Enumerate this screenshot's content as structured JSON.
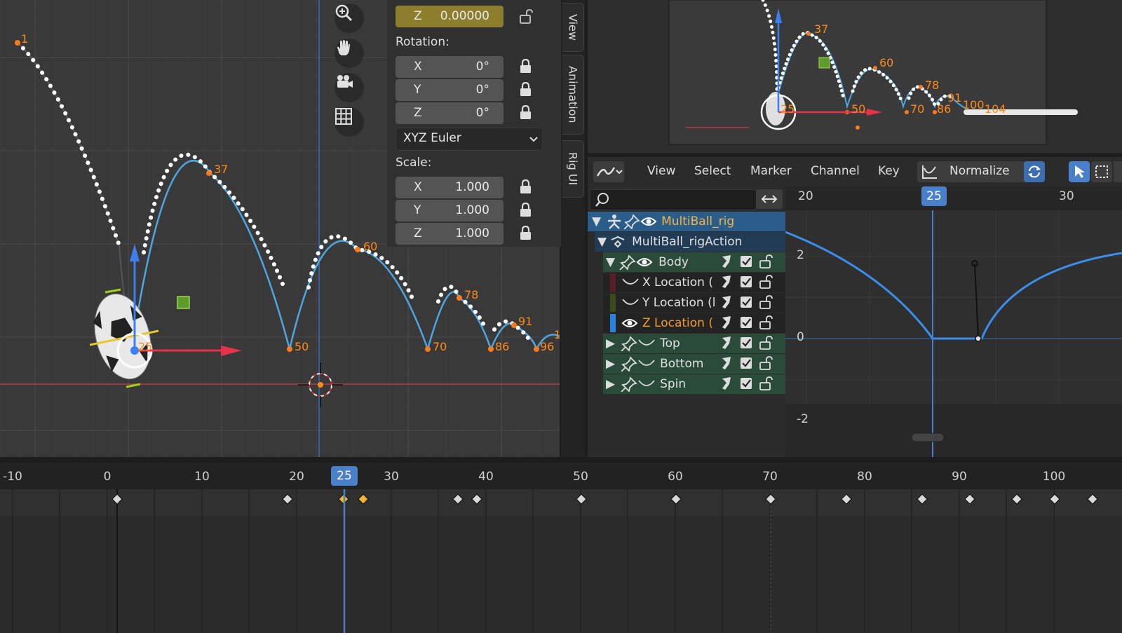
{
  "viewport": {
    "frame_labels": [
      "1",
      "37",
      "60",
      "78",
      "91",
      "25",
      "50",
      "70",
      "86",
      "96",
      "1"
    ],
    "nav_icons": [
      "zoom-icon",
      "hand-pan-icon",
      "camera-icon",
      "grid-icon"
    ]
  },
  "npanel": {
    "location_z": {
      "axis": "Z",
      "value": "0.00000"
    },
    "rotation_label": "Rotation:",
    "rotation": [
      {
        "axis": "X",
        "value": "0°"
      },
      {
        "axis": "Y",
        "value": "0°"
      },
      {
        "axis": "Z",
        "value": "0°"
      }
    ],
    "rotation_mode": "XYZ Euler",
    "scale_label": "Scale:",
    "scale": [
      {
        "axis": "X",
        "value": "1.000"
      },
      {
        "axis": "Y",
        "value": "1.000"
      },
      {
        "axis": "Z",
        "value": "1.000"
      }
    ]
  },
  "side_tabs": [
    "View",
    "Animation",
    "Rig UI"
  ],
  "preview": {
    "frame_labels": [
      "37",
      "60",
      "78",
      "91",
      "25",
      "50",
      "70",
      "86",
      "100",
      "104"
    ]
  },
  "graph": {
    "menu": [
      "View",
      "Select",
      "Marker",
      "Channel",
      "Key"
    ],
    "normalize_label": "Normalize",
    "search_placeholder": "",
    "ruler": {
      "left": "20",
      "current": "25",
      "right": "30"
    },
    "y_ticks": [
      "2",
      "0",
      "-2"
    ],
    "channels": [
      {
        "label": "MultiBall_rig",
        "level": 0
      },
      {
        "label": "MultiBall_rigAction",
        "level": 1
      },
      {
        "label": "Body",
        "level": 2
      },
      {
        "label": "X Location (",
        "level": 3
      },
      {
        "label": "Y Location (l",
        "level": 3
      },
      {
        "label": "Z Location (",
        "level": 3
      },
      {
        "label": "Top",
        "level": 2
      },
      {
        "label": "Bottom",
        "level": 2
      },
      {
        "label": "Spin",
        "level": 2
      }
    ],
    "colors": {
      "curve": "#3a8eed",
      "selected_channel": "#f29d2b",
      "header_row": "#2b5d8b"
    }
  },
  "timeline": {
    "ticks": [
      "-10",
      "0",
      "10",
      "20",
      "30",
      "40",
      "50",
      "60",
      "70",
      "80",
      "90",
      "100"
    ],
    "current_frame": "25",
    "colors": {
      "keyframe": "#d9d9d9",
      "selected_keyframe": "#f5b531",
      "playhead": "#4a7fc9"
    }
  }
}
